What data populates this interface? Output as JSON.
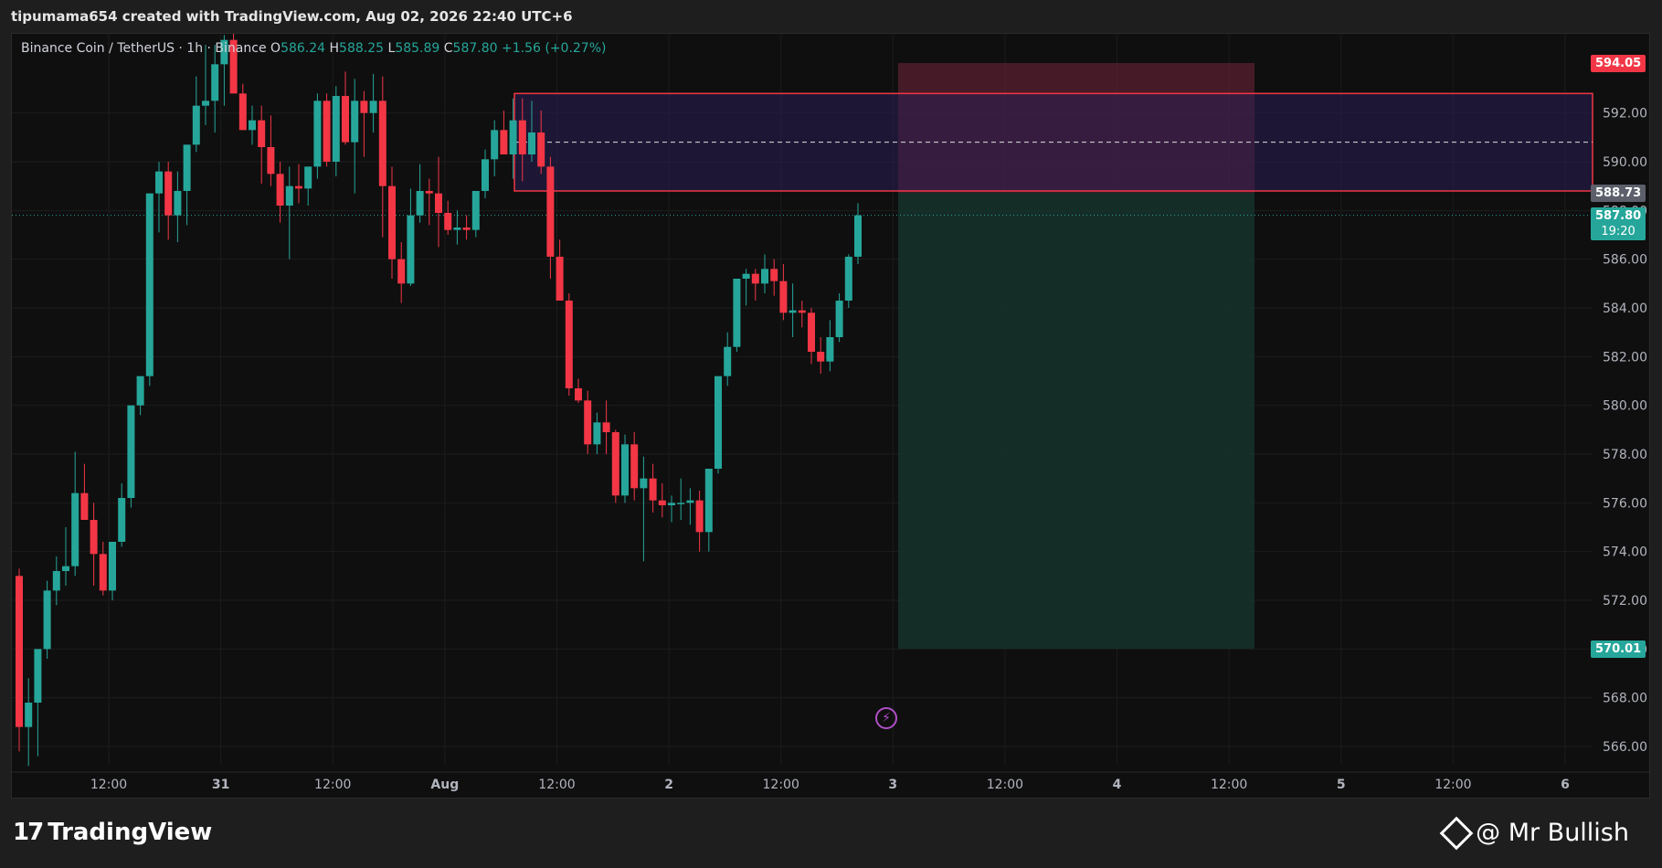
{
  "header": {
    "attribution": "tipumama654 created with TradingView.com, Aug 02, 2026 22:40 UTC+6"
  },
  "legend": {
    "symbol": "Binance Coin / TetherUS · 1h · Binance",
    "o_label": "O",
    "open": "586.24",
    "h_label": "H",
    "high": "588.25",
    "l_label": "L",
    "low": "585.89",
    "c_label": "C",
    "close": "587.80",
    "change": "+1.56 (+0.27%)"
  },
  "colors": {
    "up": "#26a69a",
    "down": "#f23645",
    "background": "#0f0f0f",
    "zone_fill": "#2a1f55",
    "zone_border": "#f23645",
    "stop_fill": "#5a2030",
    "target_fill": "#16332c"
  },
  "price_axis": {
    "ticks": [
      "592.00",
      "590.00",
      "588.00",
      "586.00",
      "584.00",
      "582.00",
      "580.00",
      "578.00",
      "576.00",
      "574.00",
      "572.00",
      "570.00",
      "568.00",
      "566.00"
    ],
    "range": [
      565.3,
      595.0
    ]
  },
  "time_axis": {
    "ticks": [
      "12:00",
      "31",
      "12:00",
      "Aug",
      "12:00",
      "2",
      "12:00",
      "3",
      "12:00",
      "4",
      "12:00",
      "5",
      "12:00",
      "6"
    ]
  },
  "price_tags": {
    "stop": "594.05",
    "entry": "588.73",
    "current": "587.80",
    "countdown": "19:20",
    "target": "570.01"
  },
  "zone": {
    "top": 592.8,
    "bottom": 588.8,
    "mid": 590.8
  },
  "position": {
    "stop": 594.05,
    "entry": 588.73,
    "target": 570.01
  },
  "chart_data": {
    "type": "candlestick",
    "interval": "1h",
    "candles": [
      [
        573.0,
        573.3,
        565.8,
        566.8
      ],
      [
        566.8,
        568.8,
        565.2,
        567.8
      ],
      [
        567.8,
        569.2,
        565.6,
        570.0
      ],
      [
        570.0,
        572.8,
        569.6,
        572.4
      ],
      [
        572.4,
        573.8,
        571.8,
        573.2
      ],
      [
        573.2,
        575.0,
        572.6,
        573.4
      ],
      [
        573.4,
        578.1,
        573.0,
        576.4
      ],
      [
        576.4,
        577.6,
        575.4,
        575.3
      ],
      [
        575.3,
        576.0,
        572.6,
        573.9
      ],
      [
        573.9,
        574.4,
        572.2,
        572.4
      ],
      [
        572.4,
        574.1,
        572.0,
        574.4
      ],
      [
        574.4,
        576.8,
        574.2,
        576.2
      ],
      [
        576.2,
        578.0,
        575.8,
        580.0
      ],
      [
        580.0,
        580.9,
        579.6,
        581.2
      ],
      [
        581.2,
        584.0,
        580.8,
        588.7
      ],
      [
        588.7,
        590.0,
        587.1,
        589.6
      ],
      [
        589.6,
        590.0,
        586.8,
        587.8
      ],
      [
        587.8,
        589.6,
        586.7,
        588.8
      ],
      [
        588.8,
        590.0,
        587.4,
        590.7
      ],
      [
        590.7,
        593.5,
        590.4,
        592.3
      ],
      [
        592.3,
        594.8,
        591.5,
        592.5
      ],
      [
        592.5,
        594.8,
        591.2,
        594.0
      ],
      [
        594.0,
        595.2,
        592.3,
        595.0
      ],
      [
        595.0,
        595.4,
        592.9,
        592.8
      ],
      [
        592.8,
        593.2,
        591.3,
        591.3
      ],
      [
        591.3,
        592.3,
        590.7,
        591.7
      ],
      [
        591.7,
        592.3,
        589.1,
        590.6
      ],
      [
        590.6,
        591.9,
        589.0,
        589.5
      ],
      [
        589.5,
        590.0,
        587.5,
        588.2
      ],
      [
        588.2,
        589.8,
        586.0,
        589.0
      ],
      [
        589.0,
        589.9,
        588.3,
        588.9
      ],
      [
        588.9,
        589.5,
        588.2,
        589.8
      ],
      [
        589.8,
        592.8,
        589.3,
        592.5
      ],
      [
        592.5,
        592.8,
        589.8,
        590.0
      ],
      [
        590.0,
        593.1,
        589.4,
        592.7
      ],
      [
        592.7,
        593.7,
        590.7,
        590.8
      ],
      [
        590.8,
        593.4,
        588.7,
        592.5
      ],
      [
        592.5,
        592.9,
        590.2,
        592.0
      ],
      [
        592.0,
        593.6,
        591.2,
        592.5
      ],
      [
        592.5,
        593.5,
        586.9,
        589.0
      ],
      [
        589.0,
        589.8,
        585.2,
        586.0
      ],
      [
        586.0,
        586.7,
        584.2,
        585.0
      ],
      [
        585.0,
        588.9,
        584.9,
        587.8
      ],
      [
        587.8,
        589.9,
        587.5,
        588.8
      ],
      [
        588.8,
        589.3,
        587.4,
        588.7
      ],
      [
        588.7,
        590.2,
        586.5,
        587.9
      ],
      [
        587.9,
        588.4,
        587.0,
        587.2
      ],
      [
        587.2,
        588.0,
        586.6,
        587.3
      ],
      [
        587.3,
        587.8,
        586.8,
        587.2
      ],
      [
        587.2,
        588.0,
        586.9,
        588.8
      ],
      [
        588.8,
        590.5,
        588.5,
        590.1
      ],
      [
        590.1,
        591.7,
        589.4,
        591.3
      ],
      [
        591.3,
        592.1,
        590.5,
        590.3
      ],
      [
        590.3,
        592.6,
        589.3,
        591.7
      ],
      [
        591.7,
        592.6,
        589.2,
        590.3
      ],
      [
        590.3,
        592.5,
        590.0,
        591.2
      ],
      [
        591.2,
        592.1,
        589.5,
        589.8
      ],
      [
        589.8,
        590.2,
        585.2,
        586.1
      ],
      [
        586.1,
        586.8,
        584.4,
        584.3
      ],
      [
        584.3,
        584.6,
        580.4,
        580.7
      ],
      [
        580.7,
        581.1,
        580.1,
        580.2
      ],
      [
        580.2,
        580.6,
        578.0,
        578.4
      ],
      [
        578.4,
        579.7,
        578.0,
        579.3
      ],
      [
        579.3,
        580.2,
        578.0,
        578.9
      ],
      [
        578.9,
        579.0,
        576.0,
        576.3
      ],
      [
        576.3,
        578.8,
        576.0,
        578.4
      ],
      [
        578.4,
        578.9,
        576.1,
        576.6
      ],
      [
        576.6,
        577.9,
        573.6,
        577.0
      ],
      [
        577.0,
        577.6,
        575.6,
        576.1
      ],
      [
        576.1,
        576.8,
        575.4,
        575.9
      ],
      [
        575.9,
        576.3,
        575.2,
        576.0
      ],
      [
        576.0,
        577.0,
        575.3,
        576.0
      ],
      [
        576.0,
        576.6,
        575.1,
        576.1
      ],
      [
        576.1,
        576.5,
        574.0,
        574.8
      ],
      [
        574.8,
        576.3,
        574.0,
        577.4
      ],
      [
        577.4,
        581.1,
        577.2,
        581.2
      ],
      [
        581.2,
        583.0,
        580.8,
        582.4
      ],
      [
        582.4,
        584.3,
        582.2,
        585.2
      ],
      [
        585.2,
        585.6,
        584.1,
        585.4
      ],
      [
        585.4,
        585.6,
        584.3,
        585.0
      ],
      [
        585.0,
        586.2,
        584.6,
        585.6
      ],
      [
        585.6,
        586.0,
        584.5,
        585.1
      ],
      [
        585.1,
        585.8,
        583.5,
        583.8
      ],
      [
        583.8,
        585.0,
        582.8,
        583.9
      ],
      [
        583.9,
        584.3,
        583.2,
        583.8
      ],
      [
        583.8,
        584.0,
        581.7,
        582.2
      ],
      [
        582.2,
        582.8,
        581.3,
        581.8
      ],
      [
        581.8,
        583.5,
        581.4,
        582.8
      ],
      [
        582.8,
        584.6,
        582.6,
        584.3
      ],
      [
        584.3,
        586.2,
        584.0,
        586.1
      ],
      [
        586.1,
        588.3,
        585.8,
        587.8
      ]
    ]
  },
  "watermark": {
    "brand": "TradingView",
    "author": "@ Mr Bullish"
  }
}
